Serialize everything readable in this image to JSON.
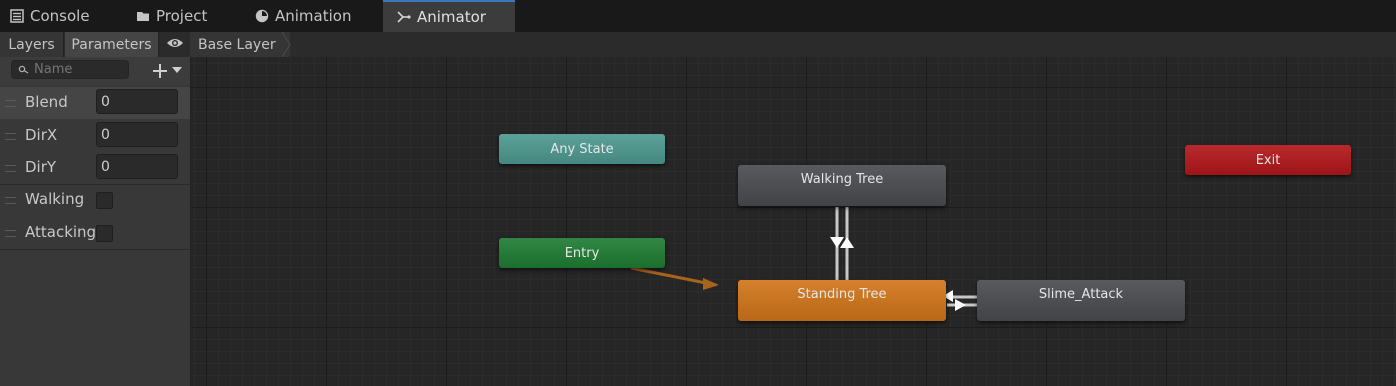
{
  "tabs": [
    {
      "label": "Console",
      "icon": "console-icon"
    },
    {
      "label": "Project",
      "icon": "folder-icon"
    },
    {
      "label": "Animation",
      "icon": "animation-clock-icon"
    },
    {
      "label": "Animator",
      "icon": "animator-icon",
      "active": true
    }
  ],
  "left_panel": {
    "tabs": [
      "Layers",
      "Parameters"
    ],
    "active_tab": "Parameters",
    "visibility_icon": "eye-icon",
    "search_placeholder": "Name",
    "add_icon": "plus-icon",
    "dropdown_icon": "triangle-down-icon",
    "parameters": [
      {
        "name": "Blend",
        "type": "float",
        "value": "0"
      },
      {
        "name": "DirX",
        "type": "float",
        "value": "0"
      },
      {
        "name": "DirY",
        "type": "float",
        "value": "0"
      },
      {
        "name": "Walking",
        "type": "bool",
        "value": false
      },
      {
        "name": "Attacking",
        "type": "bool",
        "value": false
      }
    ]
  },
  "breadcrumb": {
    "layer": "Base Layer"
  },
  "graph": {
    "states": {
      "any_state": {
        "label": "Any State",
        "color": "#4e9a91"
      },
      "entry": {
        "label": "Entry",
        "color": "#1f7d33"
      },
      "exit": {
        "label": "Exit",
        "color": "#b3171a"
      },
      "walking_tree": {
        "label": "Walking Tree",
        "color": "#4b4c50"
      },
      "standing_tree": {
        "label": "Standing Tree",
        "color": "#d2761a"
      },
      "slime_attack": {
        "label": "Slime_Attack",
        "color": "#4b4c50"
      }
    }
  },
  "colors": {
    "accent": "#3a79bb",
    "entry_link": "#a7651a"
  }
}
